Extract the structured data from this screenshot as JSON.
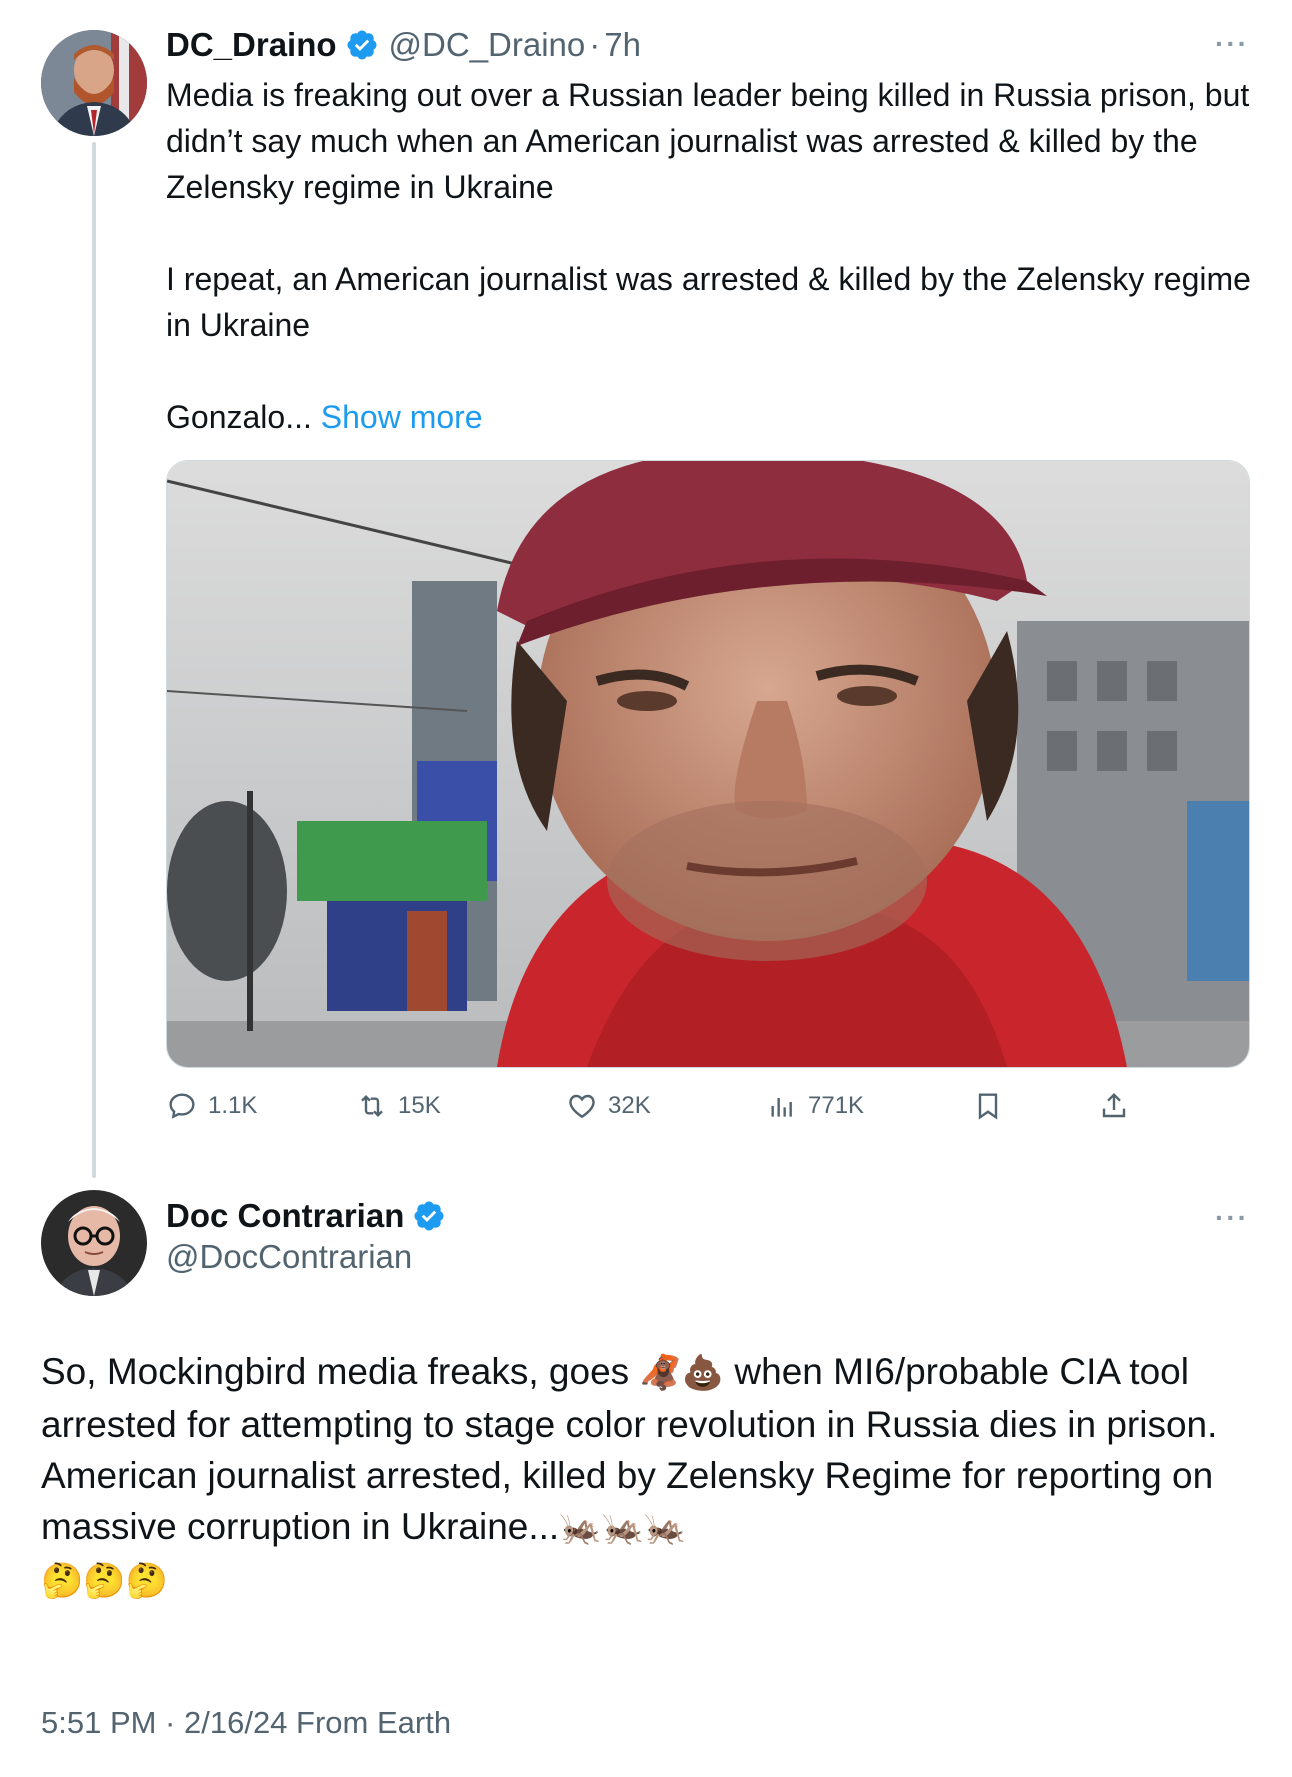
{
  "parent_tweet": {
    "display_name": "DC_Draino",
    "handle": "@DC_Draino",
    "separator": "·",
    "age": "7h",
    "more_label": "···",
    "text_lines": {
      "p1": "Media is freaking out over a Russian leader being killed in Russia prison, but didn’t say much when an American journalist was arrested & killed by the Zelensky regime in Ukraine",
      "p2": "I repeat, an American journalist was arrested & killed by the Zelensky regime in Ukraine",
      "p3_prefix": "Gonzalo...",
      "show_more": "Show more"
    },
    "stats": {
      "replies": "1.1K",
      "reposts": "15K",
      "likes": "32K",
      "views": "771K"
    }
  },
  "main_tweet": {
    "display_name": "Doc Contrarian",
    "handle": "@DocContrarian",
    "more_label": "···",
    "text": {
      "l1_before": "So, Mockingbird media freaks, goes ",
      "l1_emoji": "🦧💩",
      "l1_after": " when MI6/probable CIA tool arrested for attempting to stage color revolution in Russia dies in prison.",
      "l2": "American journalist arrested, killed by Zelensky Regime for reporting on massive corruption in Ukraine...",
      "l2_emoji": "🦗🦗🦗",
      "l3_emoji": "🤔🤔🤔"
    },
    "timestamp": "5:51 PM · 2/16/24 From Earth"
  },
  "colors": {
    "text": "#0f1419",
    "secondary": "#536471",
    "link": "#1d9bf0",
    "verified": "#1d9bf0",
    "divider": "#cfd9de"
  }
}
